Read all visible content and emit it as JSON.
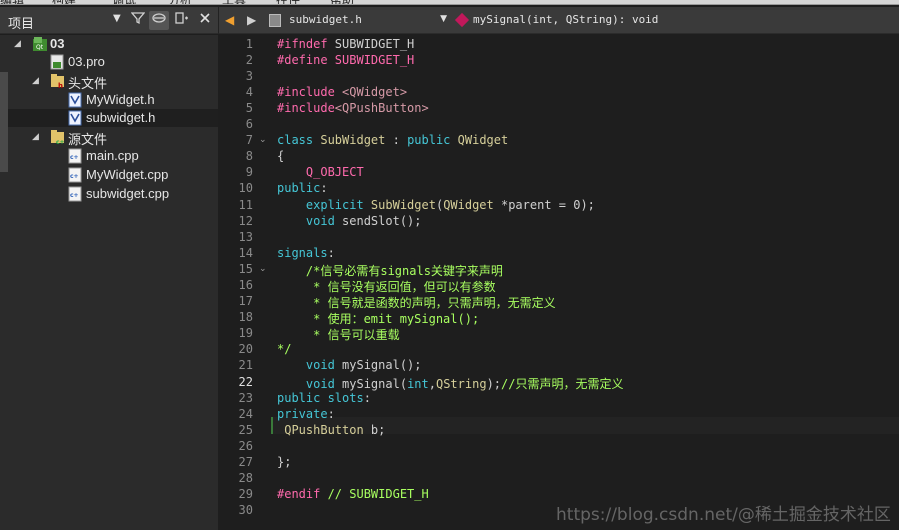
{
  "menubar": {
    "items": [
      "编辑",
      "构建",
      "调试",
      "分析",
      "工具",
      "控件",
      "帮助"
    ]
  },
  "project_panel": {
    "title": "项目",
    "tree": [
      {
        "label": "03",
        "level": 0,
        "icon": "qt-project-icon",
        "expanded": true,
        "bold": true
      },
      {
        "label": "03.pro",
        "level": 1,
        "icon": "pro-file-icon"
      },
      {
        "label": "头文件",
        "level": 1,
        "icon": "header-folder-icon",
        "expanded": true
      },
      {
        "label": "MyWidget.h",
        "level": 2,
        "icon": "header-file-icon"
      },
      {
        "label": "subwidget.h",
        "level": 2,
        "icon": "header-file-icon",
        "selected": true
      },
      {
        "label": "源文件",
        "level": 1,
        "icon": "source-folder-icon",
        "expanded": true
      },
      {
        "label": "main.cpp",
        "level": 2,
        "icon": "cpp-file-icon"
      },
      {
        "label": "MyWidget.cpp",
        "level": 2,
        "icon": "cpp-file-icon"
      },
      {
        "label": "subwidget.cpp",
        "level": 2,
        "icon": "cpp-file-icon"
      }
    ]
  },
  "editor": {
    "file_name": "subwidget.h",
    "symbol": "mySignal(int, QString): void",
    "current_line": 22,
    "lines": [
      [
        [
          "pp",
          "#ifndef "
        ],
        [
          "df",
          "SUBWIDGET_H"
        ]
      ],
      [
        [
          "pp",
          "#define "
        ],
        [
          "mac",
          "SUBWIDGET_H"
        ]
      ],
      [],
      [
        [
          "pp",
          "#include "
        ],
        [
          "inc",
          "<QWidget>"
        ]
      ],
      [
        [
          "pp",
          "#include"
        ],
        [
          "inc",
          "<QPushButton>"
        ]
      ],
      [],
      [
        [
          "kw",
          "class "
        ],
        [
          "fn",
          "SubWidget "
        ],
        [
          "df",
          ": "
        ],
        [
          "kw",
          "public "
        ],
        [
          "fn",
          "QWidget"
        ]
      ],
      [
        [
          "df",
          "{"
        ]
      ],
      [
        [
          "mac",
          "    Q_OBJECT"
        ]
      ],
      [
        [
          "kw",
          "public"
        ],
        [
          "df",
          ":"
        ]
      ],
      [
        [
          "kw",
          "    explicit "
        ],
        [
          "fn",
          "SubWidget"
        ],
        [
          "df",
          "("
        ],
        [
          "fn",
          "QWidget "
        ],
        [
          "df",
          "*parent = 0);"
        ]
      ],
      [
        [
          "kw",
          "    void "
        ],
        [
          "df",
          "sendSlot();"
        ]
      ],
      [],
      [
        [
          "sg",
          "signals"
        ],
        [
          "df",
          ":"
        ]
      ],
      [
        [
          "cm",
          "    /*信号必需有signals关键字来声明"
        ]
      ],
      [
        [
          "cm",
          "     * 信号没有返回值，但可以有参数"
        ]
      ],
      [
        [
          "cm",
          "     * 信号就是函数的声明，只需声明，无需定义"
        ]
      ],
      [
        [
          "cm",
          "     * 使用：emit mySignal();"
        ]
      ],
      [
        [
          "cm",
          "     * 信号可以重载"
        ]
      ],
      [
        [
          "cm",
          "*/"
        ]
      ],
      [
        [
          "kw",
          "    void "
        ],
        [
          "df",
          "mySignal();"
        ]
      ],
      [
        [
          "kw",
          "    void "
        ],
        [
          "df",
          "mySignal("
        ],
        [
          "kw",
          "int"
        ],
        [
          "df",
          ","
        ],
        [
          "fn",
          "QString"
        ],
        [
          "df",
          ");"
        ],
        [
          "cm",
          "//只需声明，无需定义"
        ]
      ],
      [
        [
          "kw",
          "public slots"
        ],
        [
          "df",
          ":"
        ]
      ],
      [
        [
          "kw",
          "private"
        ],
        [
          "df",
          ":"
        ]
      ],
      [
        [
          "fn",
          " QPushButton "
        ],
        [
          "df",
          "b;"
        ]
      ],
      [],
      [
        [
          "df",
          "};"
        ]
      ],
      [],
      [
        [
          "pp",
          "#endif "
        ],
        [
          "cm",
          "// SUBWIDGET_H"
        ]
      ],
      []
    ],
    "fold_lines": [
      7,
      15
    ]
  },
  "watermark": "https://blog.csdn.net/@稀土掘金技术社区"
}
